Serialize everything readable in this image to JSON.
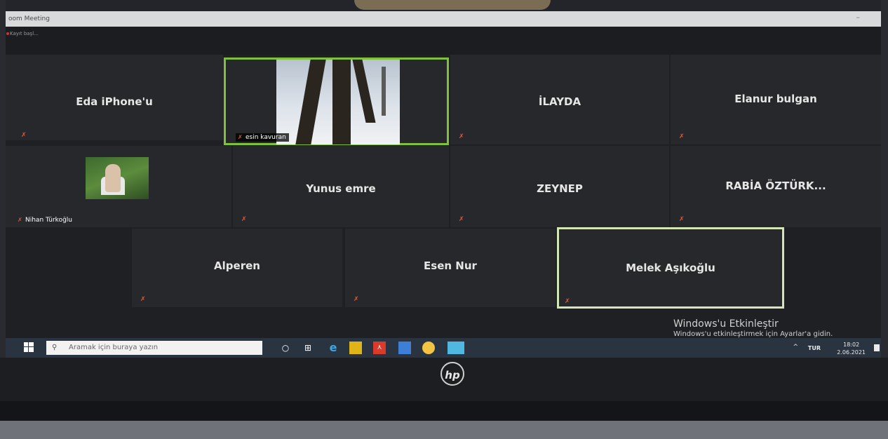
{
  "window": {
    "title": "oom Meeting"
  },
  "meeting": {
    "top_info": "Kayıt başl..."
  },
  "participants": [
    {
      "name": "Eda iPhone'u",
      "muted": true
    },
    {
      "name": "esin kavuran",
      "muted": true,
      "video": true
    },
    {
      "name": "İLAYDA",
      "muted": true
    },
    {
      "name": "Elanur bulgan",
      "muted": true
    },
    {
      "name": "Nihan Türkoğlu",
      "muted": true,
      "video": true
    },
    {
      "name": "Yunus emre",
      "muted": true
    },
    {
      "name": "ZEYNEP",
      "muted": true
    },
    {
      "name": "RABİA  ÖZTÜRK...",
      "muted": true
    },
    {
      "name": "Alperen",
      "muted": true
    },
    {
      "name": "Esen Nur",
      "muted": true
    },
    {
      "name": "Melek Aşıkoğlu",
      "muted": true
    }
  ],
  "activation": {
    "title": "Windows'u Etkinleştir",
    "subtitle": "Windows'u etkinleştirmek için Ayarlar'a gidin."
  },
  "taskbar": {
    "search_placeholder": "Aramak için buraya yazın",
    "tray": {
      "chevron": "^",
      "language": "TUR",
      "time": "18:02",
      "date": "2.06.2021"
    }
  },
  "laptop": {
    "brand": "hp"
  },
  "colors": {
    "active_speaker": "#7fc13b",
    "muted_icon": "#e05a3a",
    "taskbar": "#2a3440"
  }
}
